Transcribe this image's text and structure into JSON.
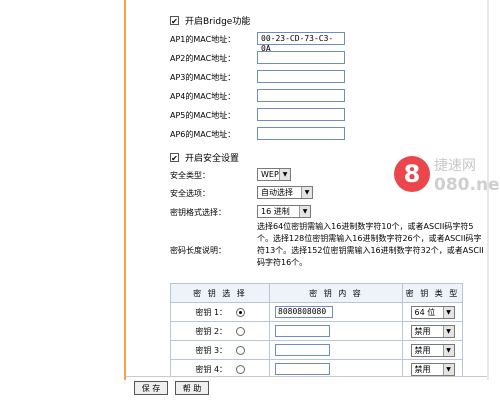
{
  "bridge": {
    "label": "开启Bridge功能",
    "checked": true,
    "ap": [
      {
        "label": "AP1的MAC地址：",
        "value": "00-23-CD-73-C3-0A"
      },
      {
        "label": "AP2的MAC地址：",
        "value": ""
      },
      {
        "label": "AP3的MAC地址：",
        "value": ""
      },
      {
        "label": "AP4的MAC地址：",
        "value": ""
      },
      {
        "label": "AP5的MAC地址：",
        "value": ""
      },
      {
        "label": "AP6的MAC地址：",
        "value": ""
      }
    ]
  },
  "security": {
    "enable_label": "开启安全设置",
    "checked": true,
    "type_label": "安全类型：",
    "type_value": "WEP",
    "option_label": "安全选项：",
    "option_value": "自动选择",
    "format_label": "密钥格式选择：",
    "format_value": "16 进制",
    "length_label": "密码长度说明：",
    "length_desc": "选择64位密钥需输入16进制数字符10个，或者ASCII码字符5个。选择128位密钥需输入16进制数字符26个，或者ASCII码字符13个。选择152位密钥需输入16进制数字符32个，或者ASCII码字符16个。"
  },
  "keys_table": {
    "headers": [
      "密 钥 选 择",
      "密 钥 内 容",
      "密 钥 类 型"
    ],
    "rows": [
      {
        "label": "密钥 1：",
        "selected": true,
        "content": "8080808080",
        "type": "64 位"
      },
      {
        "label": "密钥 2：",
        "selected": false,
        "content": "",
        "type": "禁用"
      },
      {
        "label": "密钥 3：",
        "selected": false,
        "content": "",
        "type": "禁用"
      },
      {
        "label": "密钥 4：",
        "selected": false,
        "content": "",
        "type": "禁用"
      }
    ]
  },
  "buttons": {
    "save": "保 存",
    "help": "帮 助"
  },
  "watermark": {
    "digit": "8",
    "text": "捷速网",
    "domain": "080.net"
  },
  "colors": {
    "frame": "#f4a24c",
    "input_border": "#6f8dbf",
    "watermark_red": "#e8262b"
  }
}
